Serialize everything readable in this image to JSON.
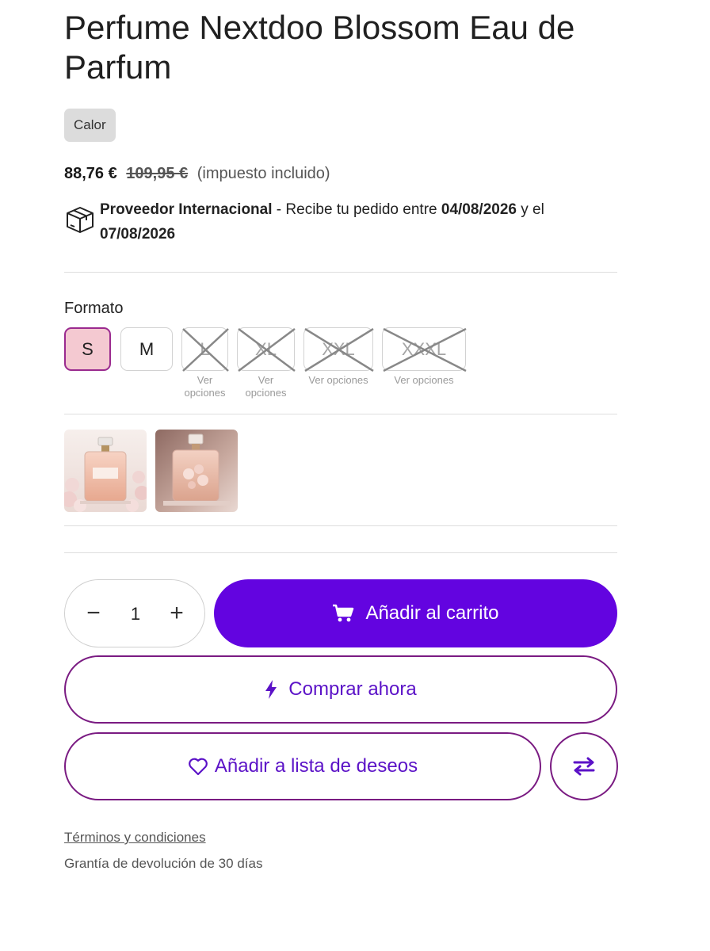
{
  "product": {
    "title": "Perfume Nextdoo Blossom Eau de Parfum",
    "tag": "Calor",
    "price_current": "88,76 €",
    "price_old": "109,95 €",
    "tax_note": "(impuesto incluido)"
  },
  "shipping": {
    "icon": "package-box-icon",
    "provider": "Proveedor Internacional",
    "text_before": " - Recibe tu pedido entre ",
    "date_from": "04/08/2026",
    "text_mid": " y el",
    "date_to": "07/08/2026"
  },
  "format": {
    "label": "Formato",
    "sizes": [
      {
        "label": "S",
        "state": "selected",
        "note": ""
      },
      {
        "label": "M",
        "state": "available",
        "note": ""
      },
      {
        "label": "L",
        "state": "unavailable",
        "note": "Ver opciones"
      },
      {
        "label": "XL",
        "state": "unavailable",
        "note": "Ver opciones"
      },
      {
        "label": "XXL",
        "state": "unavailable",
        "note": "Ver opciones"
      },
      {
        "label": "XXXL",
        "state": "unavailable",
        "note": "Ver opciones"
      }
    ]
  },
  "gallery": {
    "thumbnails": [
      "perfume-bottle-with-blossoms",
      "perfume-bottle-with-flowers-inside"
    ]
  },
  "quantity": {
    "value": "1",
    "minus": "−",
    "plus": "+"
  },
  "buttons": {
    "add_to_cart": "Añadir al carrito",
    "buy_now": "Comprar ahora",
    "add_to_wishlist": "Añadir a lista de deseos"
  },
  "colors": {
    "primary": "#6304e0",
    "outline": "#7a1b82",
    "selected_size_bg": "#f4c9d1"
  },
  "footer": {
    "terms": "Términos y condiciones",
    "guarantee": "Grantía de devolución de 30 días"
  }
}
